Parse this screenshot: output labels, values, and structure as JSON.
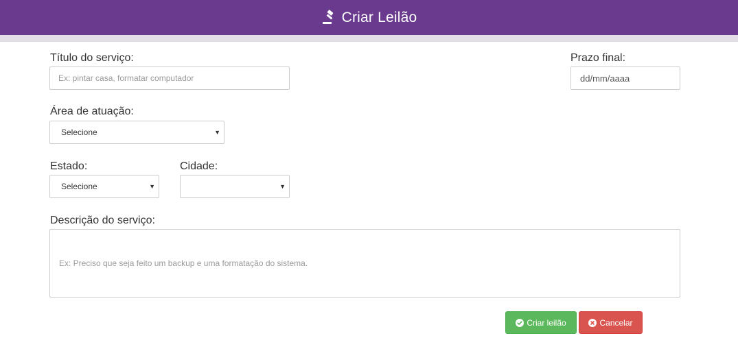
{
  "header": {
    "title": "Criar Leilão"
  },
  "form": {
    "titulo": {
      "label": "Título do serviço:",
      "placeholder": "Ex: pintar casa, formatar computador"
    },
    "prazo": {
      "label": "Prazo final:",
      "value": "dd/mm/aaaa"
    },
    "area": {
      "label": "Área de atuação:",
      "selected": "Selecione"
    },
    "estado": {
      "label": "Estado:",
      "selected": "Selecione"
    },
    "cidade": {
      "label": "Cidade:",
      "selected": ""
    },
    "descricao": {
      "label": "Descrição do serviço:",
      "placeholder": "Ex: Preciso que seja feito um backup e uma formatação do sistema."
    }
  },
  "actions": {
    "create_label": "Criar leilão",
    "cancel_label": "Cancelar"
  },
  "colors": {
    "header": "#6a3a8f",
    "success": "#5cb85c",
    "danger": "#d9534f"
  }
}
